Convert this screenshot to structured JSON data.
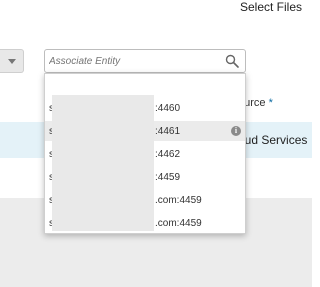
{
  "header": {
    "select_files_label": "Select Files"
  },
  "form": {
    "source_label": "ource",
    "required_mark": "*",
    "selected_value": "oud Services"
  },
  "search": {
    "placeholder": "Associate Entity",
    "icon": "search-icon"
  },
  "dropdown": {
    "items": [
      {
        "prefix": "s",
        "suffix": ":4460",
        "highlighted": false
      },
      {
        "prefix": "s",
        "suffix": ":4461",
        "highlighted": true,
        "info_icon": "i"
      },
      {
        "prefix": "s",
        "suffix": ":4462",
        "highlighted": false
      },
      {
        "prefix": "s",
        "suffix": ":4459",
        "highlighted": false
      },
      {
        "prefix": "s",
        "suffix": ".com:4459",
        "highlighted": false
      },
      {
        "prefix": "s",
        "suffix": ".com:4459",
        "highlighted": false
      }
    ]
  },
  "colors": {
    "selected_row_band": "#e4f2f8",
    "highlight": "#ebebeb",
    "required": "#0a6aa1"
  }
}
